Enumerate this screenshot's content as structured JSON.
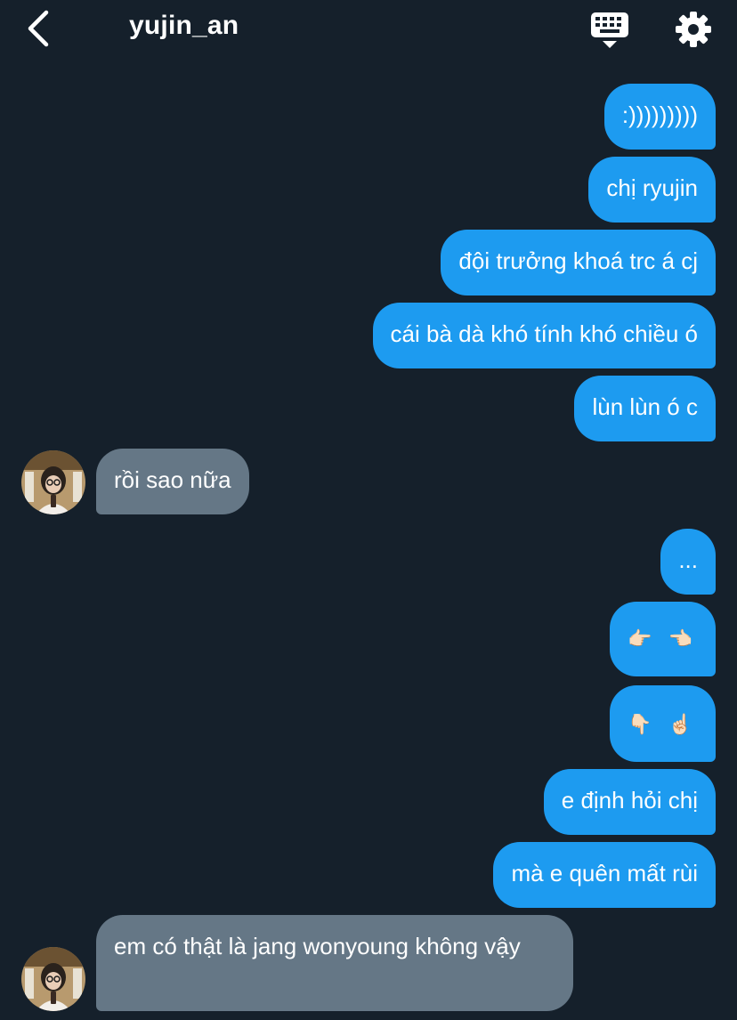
{
  "header": {
    "title": "yujin_an",
    "back_icon": "chevron-left-icon",
    "keyboard_icon": "keyboard-icon",
    "settings_icon": "gear-icon"
  },
  "messages": [
    {
      "dir": "sent",
      "text": ":)))))))))"
    },
    {
      "dir": "sent",
      "text": "chị ryujin"
    },
    {
      "dir": "sent",
      "text": "đội trưởng khoá trc á cj"
    },
    {
      "dir": "sent",
      "text": "cái bà dà khó tính khó chiều ó"
    },
    {
      "dir": "sent",
      "text": "lùn lùn ó c"
    },
    {
      "dir": "received",
      "text": "rồi sao nữa"
    },
    {
      "dir": "sent",
      "text": "..."
    },
    {
      "dir": "sent",
      "text": "👉🏻 👈🏻"
    },
    {
      "dir": "sent",
      "text": "👇🏻 ☝🏻"
    },
    {
      "dir": "sent",
      "text": "e định hỏi chị"
    },
    {
      "dir": "sent",
      "text": "mà e quên mất rùi"
    },
    {
      "dir": "received",
      "text": "em có thật là jang wonyoung không vậy"
    }
  ],
  "colors": {
    "background": "#15202b",
    "sent_bubble": "#1d9bf0",
    "received_bubble": "#657786",
    "text": "#ffffff"
  }
}
